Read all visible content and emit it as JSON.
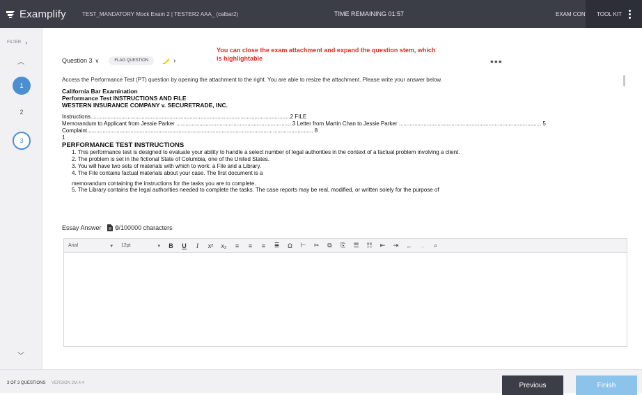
{
  "app": {
    "brand": "Examplify",
    "exam_title": "TEST_MANDATORY Mock Exam 2 | TESTER2 AAA_ (calbar2)",
    "time_remaining": "TIME REMAINING 01:57",
    "exam_controls": "EXAM CONTROLS",
    "tool_kit": "TOOL KIT"
  },
  "sidebar": {
    "filter": "FILTER",
    "questions": [
      "1",
      "2",
      "3"
    ]
  },
  "question": {
    "label": "Question 3",
    "flag": "FLAG QUESTION",
    "note": "You can close the exam attachment and expand the question stem, which is highlightable",
    "prompt": "Access the Performance Test (PT) question by opening the attachment to the right. You are able to resize the attachment. Please write your answer below."
  },
  "document": {
    "h1": "California Bar Examination",
    "h2": "Performance Test INSTRUCTIONS AND FILE",
    "h3": "WESTERN INSURANCE COMPANY v. SECURETRADE, INC.",
    "toc1": "Instructions.................................................................................................................................2 FILE",
    "toc2": "Memorandum to Applicant from Jessie Parker .......................................................................... 3 Letter from Martin Chan to Jessie Parker ............................................................................................ 5",
    "toc3": "Complaint.................................................................................................................................................. 8",
    "toc4": "1",
    "pt_heading": "PERFORMANCE TEST INSTRUCTIONS",
    "items": [
      "1. This performance test is designed to evaluate your ability to handle a select number of legal authorities in the context of a factual problem involving a client.",
      "2. The problem is set in the fictional State of Columbia, one of the United States.",
      "3. You will have two sets of materials with which to work: a File and a Library.",
      "4. The File contains factual materials about your case. The first document is a"
    ],
    "memo_line": "memorandum containing the instructions for the tasks you are to complete.",
    "item5": "5. The Library contains the legal authorities needed to complete the tasks. The case reports may be real, modified, or written solely for the purpose of"
  },
  "essay": {
    "label": "Essay Answer",
    "count": "0",
    "limit": "/100000 characters",
    "font": "Arial",
    "size": "12pt"
  },
  "footer": {
    "progress": "3 OF 3 QUESTIONS",
    "version": "VERSION 2M.4.4",
    "previous": "Previous",
    "finish": "Finish"
  },
  "colors": {
    "accent": "#4a90d0",
    "topbar": "#3b3d47",
    "note": "#e22b2b",
    "finish": "#8cc3ea"
  }
}
